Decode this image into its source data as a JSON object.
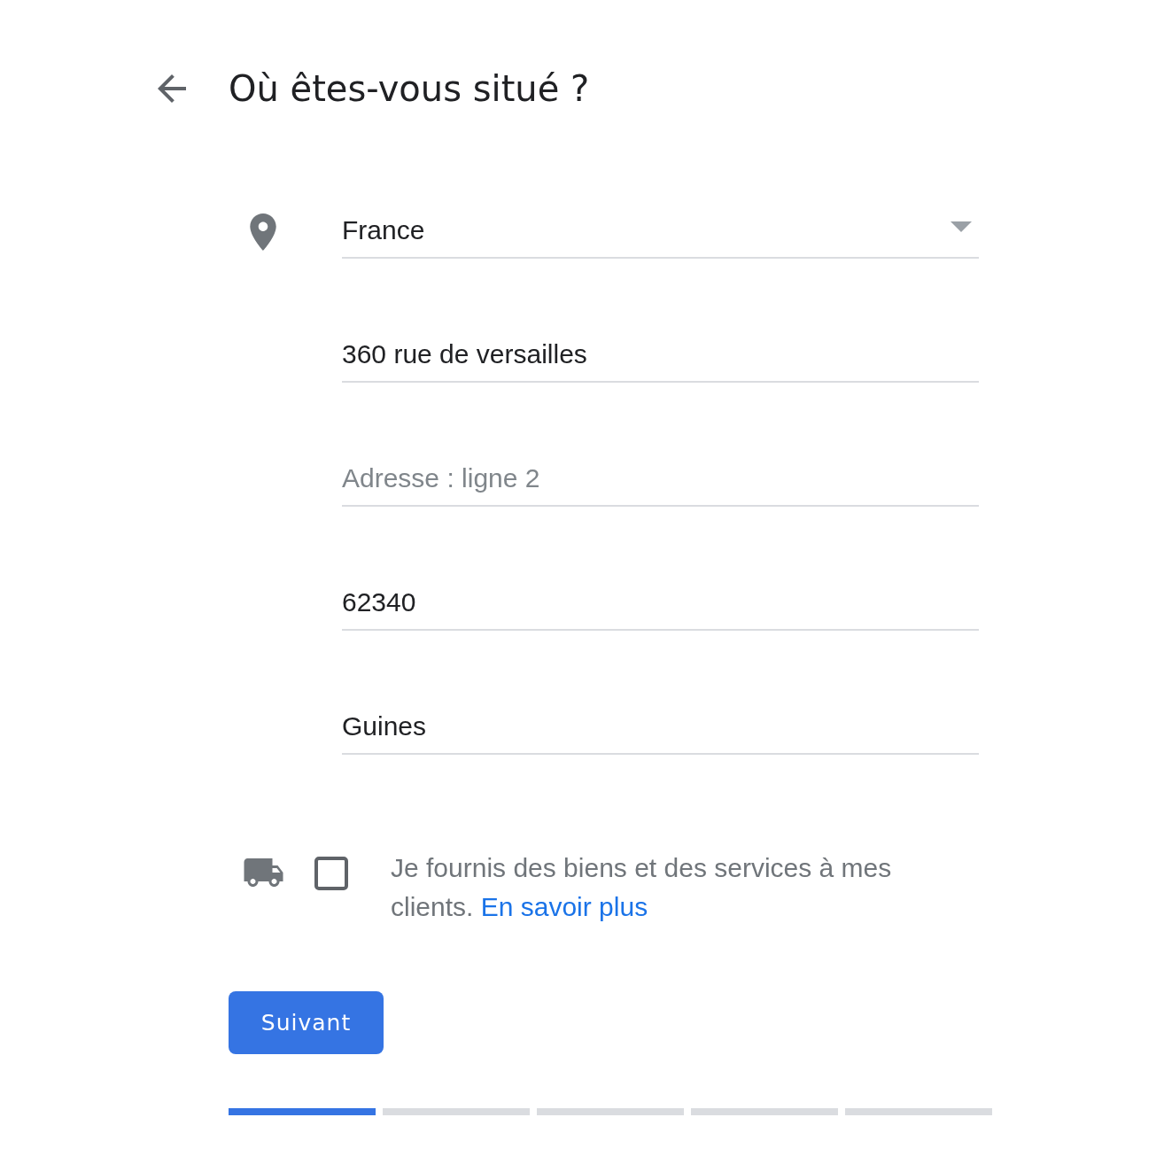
{
  "header": {
    "title": "Où êtes-vous situé ?"
  },
  "fields": [
    {
      "kind": "select",
      "value": "France"
    },
    {
      "kind": "text",
      "value": "360 rue de versailles"
    },
    {
      "kind": "text",
      "placeholder": "Adresse : ligne 2"
    },
    {
      "kind": "text",
      "value": "62340"
    },
    {
      "kind": "text",
      "value": "Guines"
    }
  ],
  "delivery": {
    "checked": false,
    "text": "Je fournis des biens et des services à mes clients.",
    "link": "En savoir plus"
  },
  "next_button": "Suivant",
  "progress": [
    {
      "done": true
    },
    {
      "done": false
    },
    {
      "done": false
    },
    {
      "done": false
    },
    {
      "done": false
    }
  ]
}
